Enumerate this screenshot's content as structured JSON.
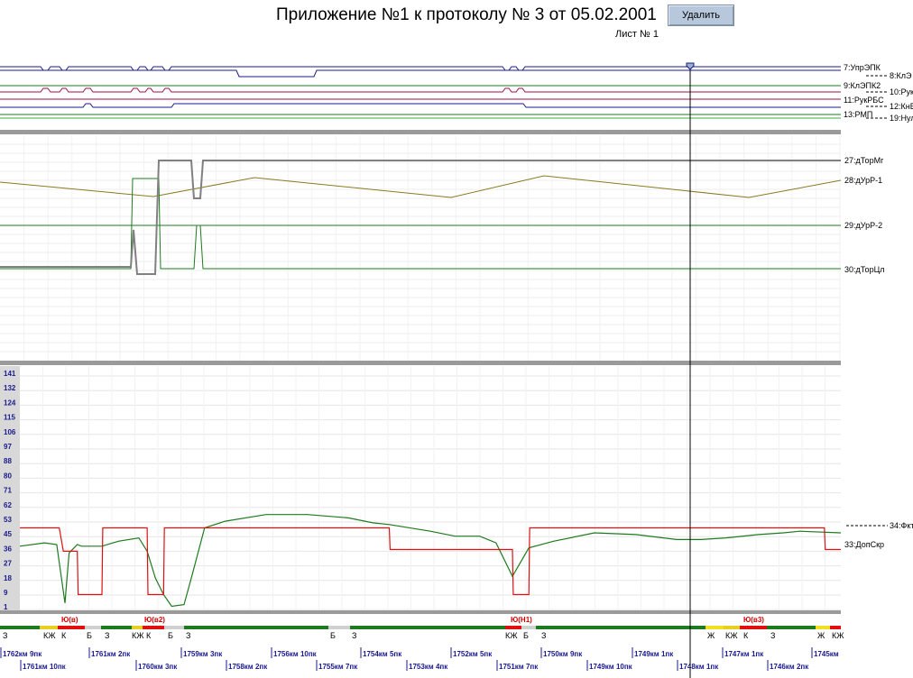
{
  "header": {
    "title": "Приложение №1 к протоколу № 3 от 05.02.2001",
    "sheet": "Лист № 1",
    "delete_label": "Удалить"
  },
  "colors": {
    "green": "#1e7a1e",
    "red": "#e01010",
    "blue": "#1a1a8c",
    "olive": "#8a7a20",
    "gray": "#808080",
    "magenta": "#a01040"
  },
  "discrete_panel": {
    "labels": [
      "7:УпрЭПК",
      "8:КлЭ",
      "9:КлЭПК2",
      "10:Рук",
      "11:РукРБС",
      "12:КнВ",
      "13:РМП",
      "19:Нул"
    ]
  },
  "analog_panel": {
    "labels": [
      "27:дТорМг",
      "28:дУрР-1",
      "29:дУрР-2",
      "30:дТорЦл"
    ]
  },
  "speed_panel": {
    "labels": [
      "34:Фкт",
      "33:ДопСкр"
    ],
    "y_ticks": [
      "141",
      "132",
      "124",
      "115",
      "106",
      "97",
      "88",
      "80",
      "71",
      "62",
      "53",
      "45",
      "36",
      "27",
      "18",
      "9",
      "1"
    ]
  },
  "signal_track": {
    "zones": [
      "Ю(в)",
      "Ю(в2)",
      "Ю(Н1)",
      "Ю(в3)"
    ],
    "letters": [
      "З",
      "КЖ",
      "К",
      "Б",
      "З",
      "КЖ",
      "К",
      "Б",
      "З",
      "Б",
      "З",
      "КЖ",
      "Б",
      "З",
      "Ж",
      "КЖ",
      "К",
      "З",
      "Ж",
      "КЖ"
    ]
  },
  "km_axis": {
    "row1": [
      "1762км 9пк",
      "1761км 2пк",
      "1759км 3пк",
      "1756км 10пк",
      "1754км 5пк",
      "1752км 5пк",
      "1750км 9пк",
      "1749км 1пк",
      "1747км 1пк",
      "1745км"
    ],
    "row2": [
      "1761км 10пк",
      "1760км 3пк",
      "1758км 2пк",
      "1755км 7пк",
      "1753км 4пк",
      "1751км 7пк",
      "1749км 10пк",
      "1748км 1пк",
      "1746км 2пк"
    ]
  },
  "chart_data": {
    "type": "line",
    "x_axis": "distance (km, pk)",
    "y_ticks": [
      141,
      132,
      124,
      115,
      106,
      97,
      88,
      80,
      71,
      62,
      53,
      45,
      36,
      27,
      18,
      9,
      1
    ],
    "ylim": [
      1,
      141
    ],
    "series": [
      {
        "name": "34:Фкт",
        "x": [
          0,
          0.03,
          0.045,
          0.055,
          0.06,
          0.07,
          0.075,
          0.085,
          0.1,
          0.12,
          0.145,
          0.155,
          0.165,
          0.175,
          0.185,
          0.2,
          0.21,
          0.225,
          0.25,
          0.3,
          0.35,
          0.4,
          0.43,
          0.45,
          0.5,
          0.53,
          0.56,
          0.58,
          0.6,
          0.62,
          0.65,
          0.7,
          0.75,
          0.8,
          0.83,
          0.86,
          0.9,
          0.93,
          0.95,
          1.0
        ],
        "y": [
          39,
          41,
          40,
          5,
          35,
          40,
          39,
          39,
          39,
          42,
          44,
          36,
          20,
          10,
          3,
          4,
          22,
          50,
          54,
          58,
          58,
          56,
          53,
          52,
          48,
          45,
          45,
          41,
          21,
          38,
          42,
          47,
          46,
          43,
          43,
          44,
          46,
          47,
          48,
          47
        ]
      },
      {
        "name": "33:ДопСкр",
        "x": [
          0,
          0.048,
          0.053,
          0.07,
          0.071,
          0.1,
          0.101,
          0.155,
          0.156,
          0.175,
          0.176,
          0.2,
          0.201,
          0.45,
          0.451,
          0.5,
          0.501,
          0.6,
          0.601,
          0.62,
          0.621,
          0.98,
          0.981,
          1.0
        ],
        "y": [
          50,
          50,
          36,
          36,
          10,
          10,
          50,
          50,
          10,
          10,
          50,
          50,
          50,
          50,
          37,
          37,
          37,
          37,
          10,
          10,
          50,
          50,
          37,
          37
        ]
      },
      {
        "name": "27:дТорМг"
      },
      {
        "name": "28:дУрР-1"
      },
      {
        "name": "29:дУрР-2"
      },
      {
        "name": "30:дТорЦл"
      }
    ]
  }
}
